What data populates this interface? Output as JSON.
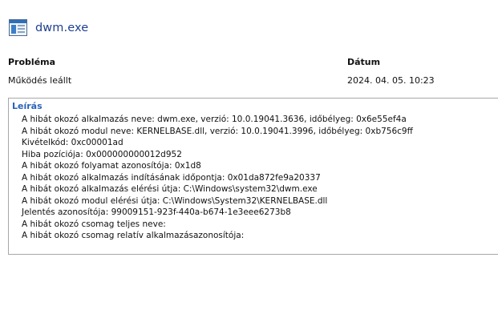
{
  "header": {
    "app_name": "dwm.exe",
    "icon": "window-app-icon"
  },
  "columns": {
    "problem_label": "Probléma",
    "problem_value": "Működés leállt",
    "date_label": "Dátum",
    "date_value": "2024. 04. 05. 10:23"
  },
  "details": {
    "title": "Leírás",
    "lines": [
      "A hibát okozó alkalmazás neve: dwm.exe, verzió: 10.0.19041.3636, időbélyeg: 0x6e55ef4a",
      "A hibát okozó modul neve: KERNELBASE.dll, verzió: 10.0.19041.3996, időbélyeg: 0xb756c9ff",
      "Kivételkód: 0xc00001ad",
      "Hiba pozíciója: 0x000000000012d952",
      "A hibát okozó folyamat azonosítója: 0x1d8",
      "A hibát okozó alkalmazás indításának időpontja: 0x01da872fe9a20337",
      "A hibát okozó alkalmazás elérési útja: C:\\Windows\\system32\\dwm.exe",
      "A hibát okozó modul elérési útja: C:\\Windows\\System32\\KERNELBASE.dll",
      "Jelentés azonosítója: 99009151-923f-440a-b674-1e3eee6273b8",
      "A hibát okozó csomag teljes neve:",
      "A hibát okozó csomag relatív alkalmazásazonosítója:"
    ]
  }
}
